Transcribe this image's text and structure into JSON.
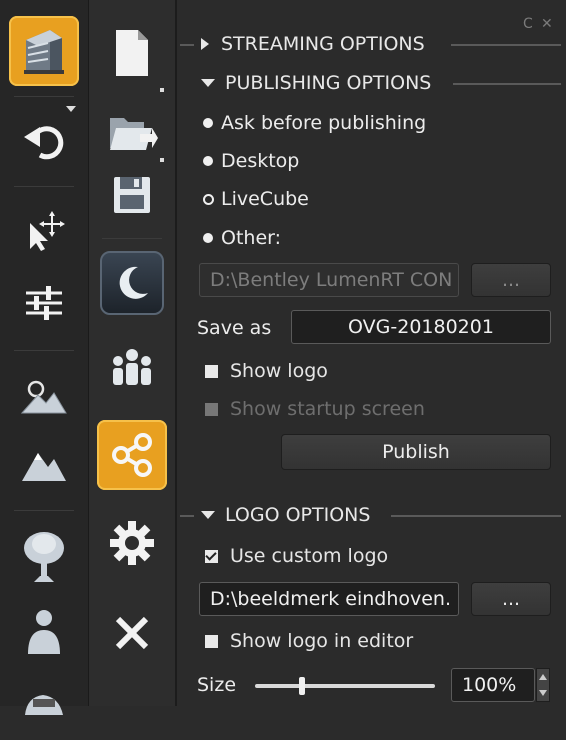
{
  "window_controls": {
    "refresh_glyph": "C",
    "close_glyph": "✕"
  },
  "left_toolbar": {
    "icons": [
      "building-icon",
      "undo-icon",
      "move-cursor-icon",
      "sliders-icon",
      "landscape-icon",
      "mountain-icon",
      "tree-icon",
      "person-icon",
      "car-icon"
    ]
  },
  "second_toolbar": {
    "icons": [
      "new-file-icon",
      "open-folder-icon",
      "save-disk-icon",
      "moon-icon",
      "people-icon",
      "share-icon",
      "gear-icon",
      "close-icon"
    ]
  },
  "streaming": {
    "title": "STREAMING OPTIONS"
  },
  "publishing": {
    "title": "PUBLISHING OPTIONS",
    "options": [
      "Ask before publishing",
      "Desktop",
      "LiveCube",
      "Other:"
    ],
    "path_value": "D:\\Bentley LumenRT CON",
    "browse_label": "...",
    "save_as_label": "Save as",
    "save_as_value": "OVG-20180201",
    "show_logo_label": "Show logo",
    "show_startup_label": "Show startup screen",
    "publish_label": "Publish"
  },
  "logo": {
    "title": "LOGO OPTIONS",
    "use_custom_label": "Use custom logo",
    "path_value": "D:\\beeldmerk eindhoven.",
    "browse_label": "...",
    "show_in_editor_label": "Show logo in editor",
    "size_label": "Size",
    "size_value": "100%",
    "size_slider_fraction": 0.25
  },
  "colors": {
    "accent": "#e8a020",
    "panel": "#2b2b2b"
  }
}
